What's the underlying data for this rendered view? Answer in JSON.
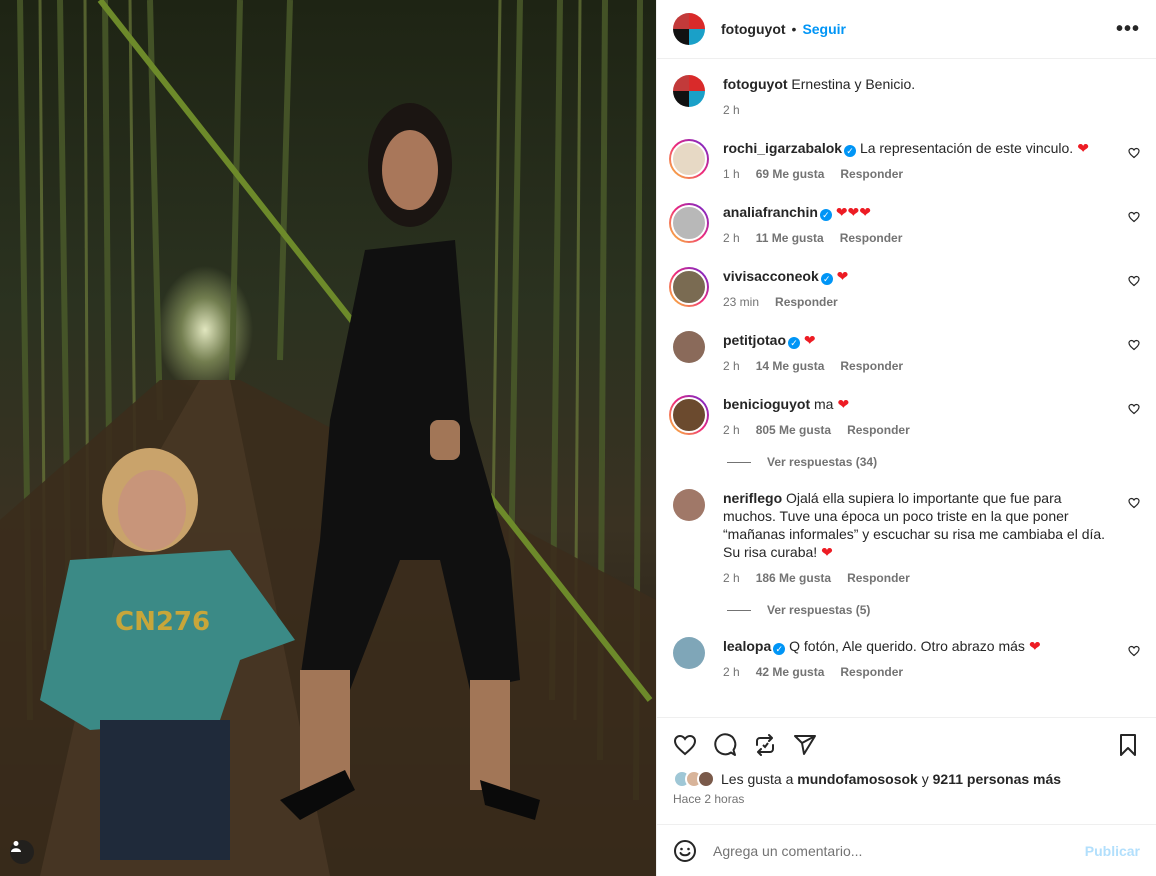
{
  "post": {
    "username": "fotoguyot",
    "dot": "•",
    "follow_label": "Seguir",
    "more_icon": "more-options-icon",
    "caption": {
      "username": "fotoguyot",
      "text": "Ernestina y Benicio.",
      "time": "2 h"
    }
  },
  "comments": [
    {
      "username": "rochi_igarzabalok",
      "verified": true,
      "text": "La representación de este vinculo.",
      "emoji": "❤",
      "time": "1 h",
      "likes": "69 Me gusta",
      "reply": "Responder",
      "avatar_color": "#e7d9c5",
      "ring": true
    },
    {
      "username": "analiafranchin",
      "verified": true,
      "text": "",
      "emoji": "❤❤❤",
      "time": "2 h",
      "likes": "11 Me gusta",
      "reply": "Responder",
      "avatar_color": "#b8b8b8",
      "ring": true
    },
    {
      "username": "vivisacconeok",
      "verified": true,
      "text": "",
      "emoji": "❤",
      "time": "23 min",
      "likes": "",
      "reply": "Responder",
      "avatar_color": "#7a6b52",
      "ring": true
    },
    {
      "username": "petitjotao",
      "verified": true,
      "text": "",
      "emoji": "❤",
      "time": "2 h",
      "likes": "14 Me gusta",
      "reply": "Responder",
      "avatar_color": "#8a6a5a",
      "ring": false
    },
    {
      "username": "benicioguyot",
      "verified": false,
      "text": "ma",
      "emoji": "❤",
      "time": "2 h",
      "likes": "805 Me gusta",
      "reply": "Responder",
      "avatar_color": "#6b4a2e",
      "ring": true
    },
    {
      "username": "neriflego",
      "verified": false,
      "text": "Ojalá ella supiera lo importante que fue para muchos. Tuve una época un poco triste en la que poner “mañanas informales” y escuchar su risa me cambiaba el día. Su risa curaba!",
      "emoji": "❤",
      "time": "2 h",
      "likes": "186 Me gusta",
      "reply": "Responder",
      "avatar_color": "#a07868",
      "ring": false
    },
    {
      "username": "lealopa",
      "verified": true,
      "text": "Q fotón, Ale querido. Otro abrazo más",
      "emoji": "❤",
      "time": "2 h",
      "likes": "42 Me gusta",
      "reply": "Responder",
      "avatar_color": "#7fa6b8",
      "ring": false
    }
  ],
  "replies": {
    "benicioguyot": "Ver respuestas (34)",
    "neriflego": "Ver respuestas (5)"
  },
  "actions": {
    "likes_prefix": "Les gusta a",
    "liker": "mundofamososok",
    "likes_mid": "y",
    "likes_count": "9211 personas más",
    "time": "Hace 2 horas"
  },
  "composer": {
    "placeholder": "Agrega un comentario...",
    "publish_label": "Publicar"
  },
  "colors": {
    "follow": "#0095f6",
    "heart": "#ed1c24",
    "verified": "#0095f6",
    "publish_disabled": "#b2dffc"
  }
}
